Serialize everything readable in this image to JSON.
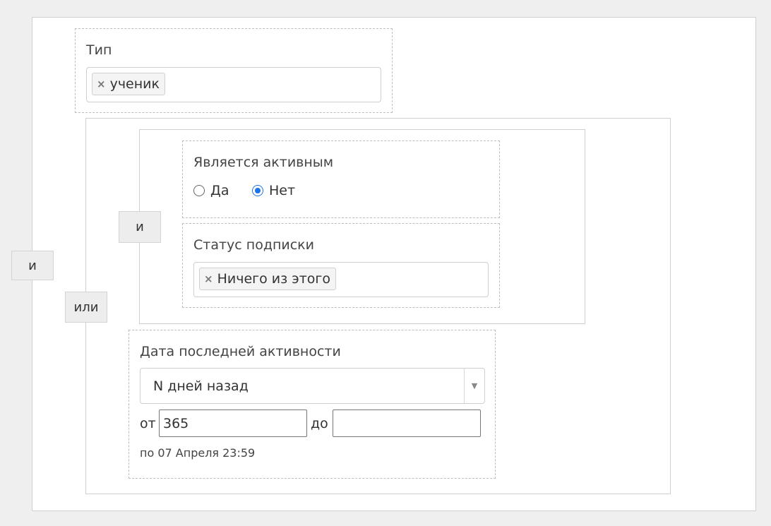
{
  "operators": {
    "outer_and": "и",
    "or": "или",
    "inner_and": "и"
  },
  "type_filter": {
    "label": "Тип",
    "chips": [
      {
        "remove": "×",
        "text": "ученик"
      }
    ]
  },
  "active_filter": {
    "label": "Является активным",
    "options": [
      {
        "label": "Да",
        "checked": false
      },
      {
        "label": "Нет",
        "checked": true
      }
    ]
  },
  "subscription_filter": {
    "label": "Статус подписки",
    "chips": [
      {
        "remove": "×",
        "text": "Ничего из этого"
      }
    ]
  },
  "last_activity_filter": {
    "label": "Дата последней активности",
    "select_value": "N дней назад",
    "dropdown_icon": "caret-down-icon",
    "from_label": "от",
    "from_value": "365",
    "to_label": "до",
    "to_value": "",
    "hint": "по 07 Апреля 23:59"
  },
  "colors": {
    "page_bg": "#efefef",
    "radio_accent": "#1a73e8"
  }
}
